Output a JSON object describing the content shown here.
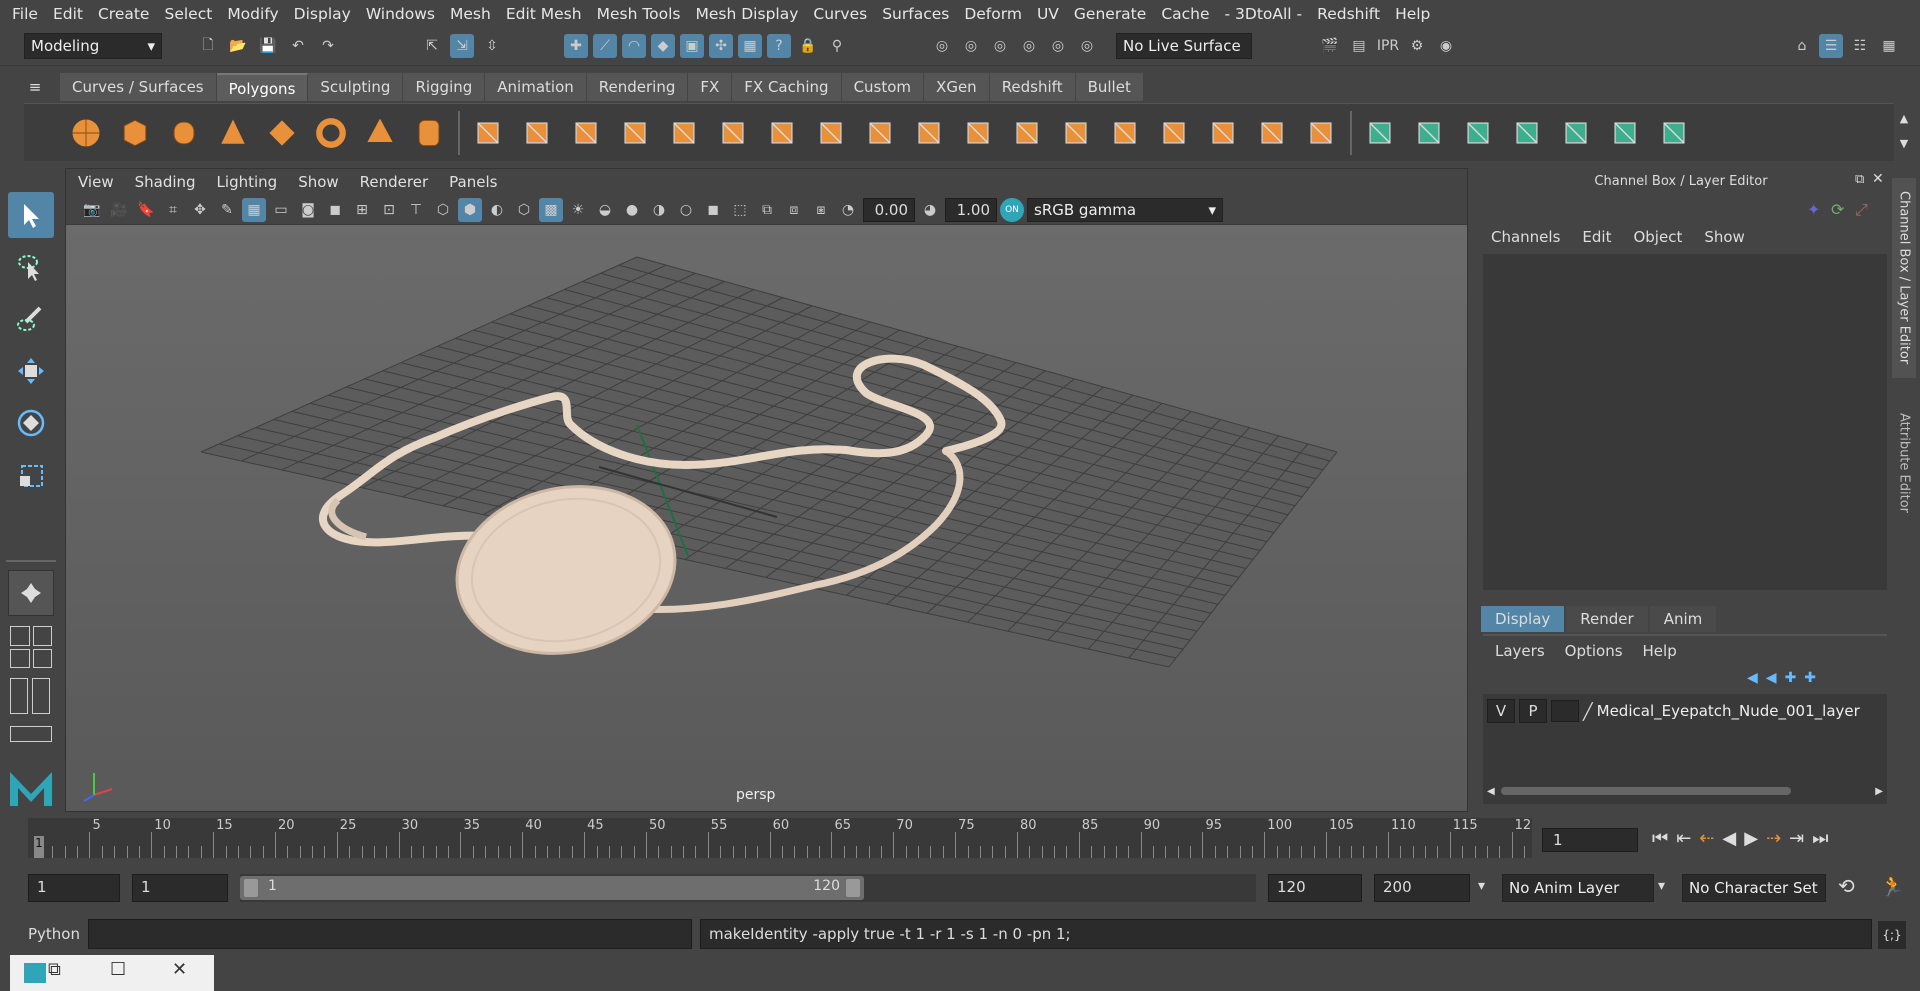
{
  "menu": [
    "File",
    "Edit",
    "Create",
    "Select",
    "Modify",
    "Display",
    "Windows",
    "Mesh",
    "Edit Mesh",
    "Mesh Tools",
    "Mesh Display",
    "Curves",
    "Surfaces",
    "Deform",
    "UV",
    "Generate",
    "Cache",
    "- 3DtoAll -",
    "Redshift",
    "Help"
  ],
  "status": {
    "mode": "Modeling",
    "live_surface": "No Live Surface"
  },
  "shelf_tabs": [
    "Curves / Surfaces",
    "Polygons",
    "Sculpting",
    "Rigging",
    "Animation",
    "Rendering",
    "FX",
    "FX Caching",
    "Custom",
    "XGen",
    "Redshift",
    "Bullet"
  ],
  "shelf_active": "Polygons",
  "viewport": {
    "menu": [
      "View",
      "Shading",
      "Lighting",
      "Show",
      "Renderer",
      "Panels"
    ],
    "exposure": "0.00",
    "gamma": "1.00",
    "color_space": "sRGB gamma",
    "camera_label": "persp"
  },
  "channel_box": {
    "title": "Channel Box / Layer Editor",
    "menu": [
      "Channels",
      "Edit",
      "Object",
      "Show"
    ],
    "layer_tabs": [
      "Display",
      "Render",
      "Anim"
    ],
    "layer_menu": [
      "Layers",
      "Options",
      "Help"
    ],
    "layer": {
      "v": "V",
      "p": "P",
      "name": "Medical_Eyepatch_Nude_001_layer"
    }
  },
  "side_tabs": [
    "Channel Box / Layer Editor",
    "Attribute Editor"
  ],
  "timeline": {
    "ticks": [
      "5",
      "10",
      "15",
      "20",
      "25",
      "30",
      "35",
      "40",
      "45",
      "50",
      "55",
      "60",
      "65",
      "70",
      "75",
      "80",
      "85",
      "90",
      "95",
      "100",
      "105",
      "110",
      "115",
      "12"
    ],
    "start_marker": "1",
    "current_frame": "1"
  },
  "range": {
    "start": "1",
    "playback_start": "1",
    "slider_start": "1",
    "slider_end": "120",
    "playback_end": "120",
    "end": "200",
    "anim_layer": "No Anim Layer",
    "char_set": "No Character Set"
  },
  "command": {
    "lang": "Python",
    "output": "makeIdentity -apply true -t 1 -r 1 -s 1 -n 0 -pn 1;"
  },
  "colors": {
    "accent": "#5285a6",
    "shelf_orange": "#e8913a",
    "shelf_green": "#3fae8f",
    "mesh": "#e6d3c2"
  }
}
